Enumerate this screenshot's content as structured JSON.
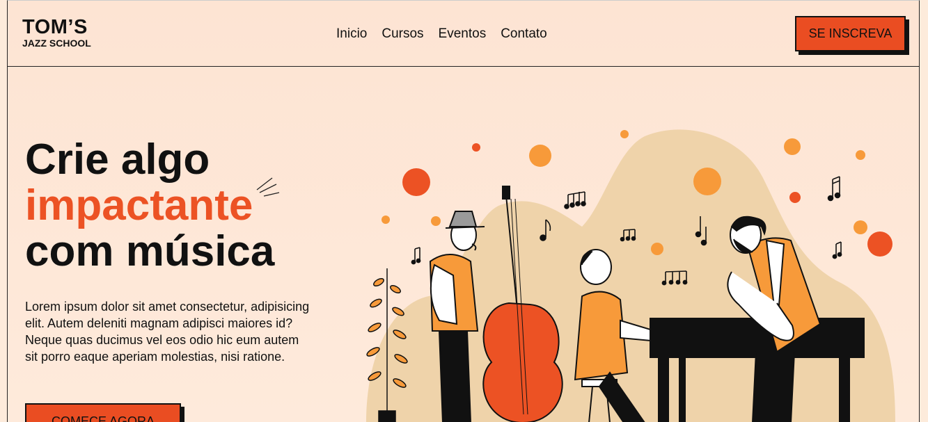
{
  "brand": {
    "name": "TOM’S",
    "subtitle": "JAZZ SCHOOL"
  },
  "nav": {
    "items": [
      "Inicio",
      "Cursos",
      "Eventos",
      "Contato"
    ]
  },
  "header": {
    "cta_label": "SE INSCREVA"
  },
  "hero": {
    "title_line1": "Crie algo",
    "title_line2": "impactante",
    "title_line3": "com música",
    "description": "Lorem ipsum dolor sit amet consectetur, adipisicing elit. Autem deleniti magnam adipisci maiores id? Neque quas ducimus vel eos odio hic eum autem sit porro eaque aperiam molestias, nisi ratione.",
    "cta_label": "COMEÇE AGORA"
  },
  "colors": {
    "accent": "#ec5224",
    "background": "#fde8d8",
    "blob": "#efd3aa",
    "orange_light": "#f79a3a"
  },
  "icons": [
    "sparkle-icon",
    "music-note-icon"
  ]
}
